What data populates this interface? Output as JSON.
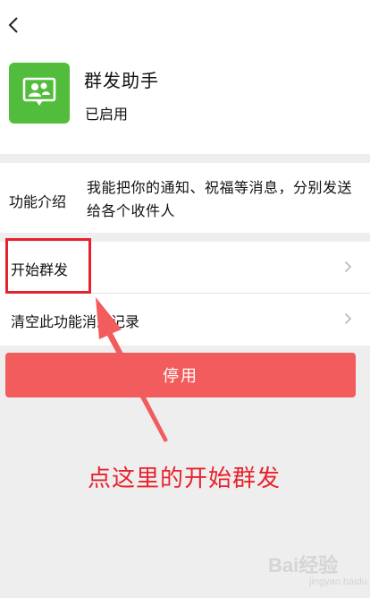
{
  "header": {
    "back_icon": "chevron-left-icon",
    "app_icon": "group-chat-icon",
    "app_icon_color": "#52bd3c",
    "app_name": "群发助手",
    "app_status": "已启用"
  },
  "intro": {
    "label": "功能介绍",
    "text": "我能把你的通知、祝福等消息，分别发送给各个收件人"
  },
  "list": {
    "items": [
      {
        "label": "开始群发",
        "icon": "chevron-right-icon"
      },
      {
        "label": "清空此功能消息记录",
        "icon": "chevron-right-icon"
      }
    ]
  },
  "button": {
    "disable_label": "停用",
    "color": "#f25c5c"
  },
  "annotation": {
    "text": "点这里的开始群发",
    "color": "#e8222c"
  },
  "watermark": {
    "text": "Bai经验",
    "sub": "jingyan.baidu.com"
  }
}
